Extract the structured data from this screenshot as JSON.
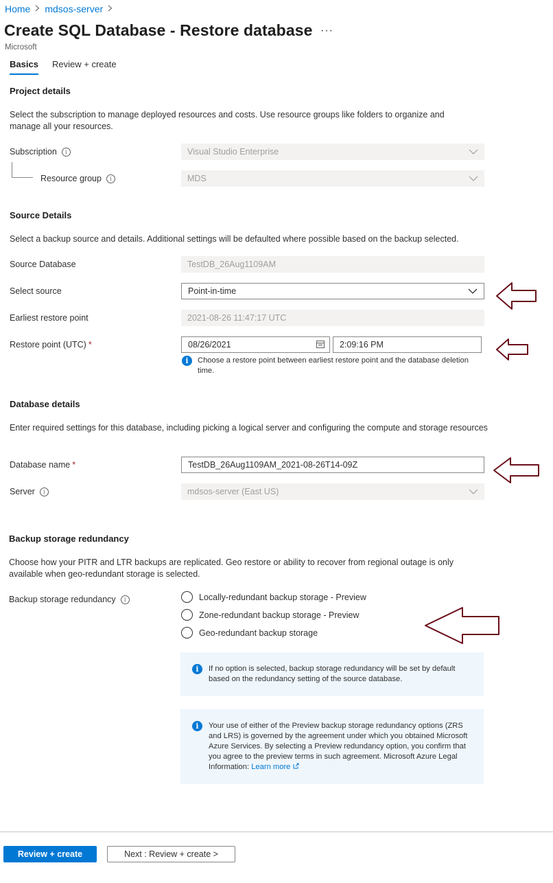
{
  "breadcrumb": {
    "home": "Home",
    "server": "mdsos-server",
    "separator": ">"
  },
  "header": {
    "title": "Create SQL Database - Restore database",
    "more": "···",
    "publisher": "Microsoft"
  },
  "tabs": [
    {
      "label": "Basics",
      "active": true
    },
    {
      "label": "Review + create",
      "active": false
    }
  ],
  "project": {
    "title": "Project details",
    "description": "Select the subscription to manage deployed resources and costs. Use resource groups like folders to organize and manage all your resources.",
    "subscription_label": "Subscription",
    "subscription_value": "Visual Studio Enterprise",
    "resource_group_label": "Resource group",
    "resource_group_value": "MDS"
  },
  "source": {
    "title": "Source Details",
    "description": "Select a backup source and details. Additional settings will be defaulted where possible based on the backup selected.",
    "source_db_label": "Source Database",
    "source_db_value": "TestDB_26Aug1109AM",
    "select_source_label": "Select source",
    "select_source_value": "Point-in-time",
    "earliest_label": "Earliest restore point",
    "earliest_value": "2021-08-26 11:47:17 UTC",
    "restore_point_label": "Restore point (UTC)",
    "required_mark": "*",
    "restore_date": "08/26/2021",
    "restore_time": "2:09:16 PM",
    "restore_hint": "Choose a restore point between earliest restore point and the database deletion time."
  },
  "database": {
    "title": "Database details",
    "description": "Enter required settings for this database, including picking a logical server and configuring the compute and storage resources",
    "name_label": "Database name",
    "name_value": "TestDB_26Aug1109AM_2021-08-26T14-09Z",
    "server_label": "Server",
    "server_value": "mdsos-server (East US)"
  },
  "backup": {
    "title": "Backup storage redundancy",
    "description": "Choose how your PITR and LTR backups are replicated. Geo restore or ability to recover from regional outage is only available when geo-redundant storage is selected.",
    "label": "Backup storage redundancy",
    "options": [
      "Locally-redundant backup storage - Preview",
      "Zone-redundant backup storage - Preview",
      "Geo-redundant backup storage"
    ],
    "info1": "If no option is selected, backup storage redundancy will be set by default based on the redundancy setting of the source database.",
    "info2": "Your use of either of the Preview backup storage redundancy options (ZRS and LRS) is governed by the agreement under which you obtained Microsoft Azure Services. By selecting a Preview redundancy option, you confirm that you agree to the preview terms in such agreement. Microsoft Azure Legal Information:",
    "learn_more": "Learn more"
  },
  "footer": {
    "review_create": "Review + create",
    "next": "Next : Review + create >"
  },
  "colors": {
    "accent": "#0078d4",
    "annotation_arrow": "#6b0f1a",
    "required": "#a4262c"
  }
}
